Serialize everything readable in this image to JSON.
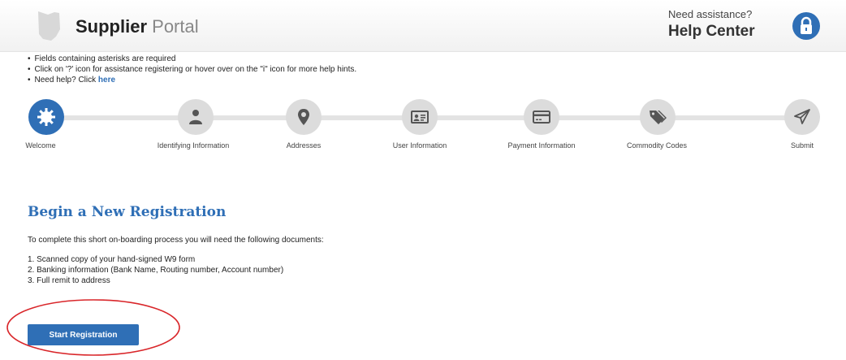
{
  "header": {
    "brand_bold": "Supplier",
    "brand_light": "Portal",
    "assist_label": "Need assistance?",
    "help_center": "Help Center",
    "lock_icon": "lock-icon"
  },
  "hints": [
    "Fields containing asterisks are required",
    "Click on '?' icon for assistance registering or hover over on the \"i\" icon for more help hints.",
    "Need help? Click"
  ],
  "hint_link": "here",
  "steps": [
    {
      "label": "Welcome",
      "icon": "gear-icon",
      "active": true
    },
    {
      "label": "Identifying Information",
      "icon": "person-icon",
      "active": false
    },
    {
      "label": "Addresses",
      "icon": "map-pin-icon",
      "active": false
    },
    {
      "label": "User Information",
      "icon": "id-card-icon",
      "active": false
    },
    {
      "label": "Payment Information",
      "icon": "credit-card-icon",
      "active": false
    },
    {
      "label": "Commodity Codes",
      "icon": "tags-icon",
      "active": false
    },
    {
      "label": "Submit",
      "icon": "paper-plane-icon",
      "active": false
    }
  ],
  "main": {
    "title": "Begin a New Registration",
    "intro": "To complete this short on-boarding process you will need the following documents:",
    "documents": [
      "1. Scanned copy of your hand-signed W9 form",
      "2. Banking information (Bank Name, Routing number, Account number)",
      "3. Full remit to address"
    ],
    "start_button": "Start Registration"
  },
  "colors": {
    "accent": "#2f6fb6",
    "step_inactive": "#dcdcdc",
    "annotation": "#d9262a"
  }
}
